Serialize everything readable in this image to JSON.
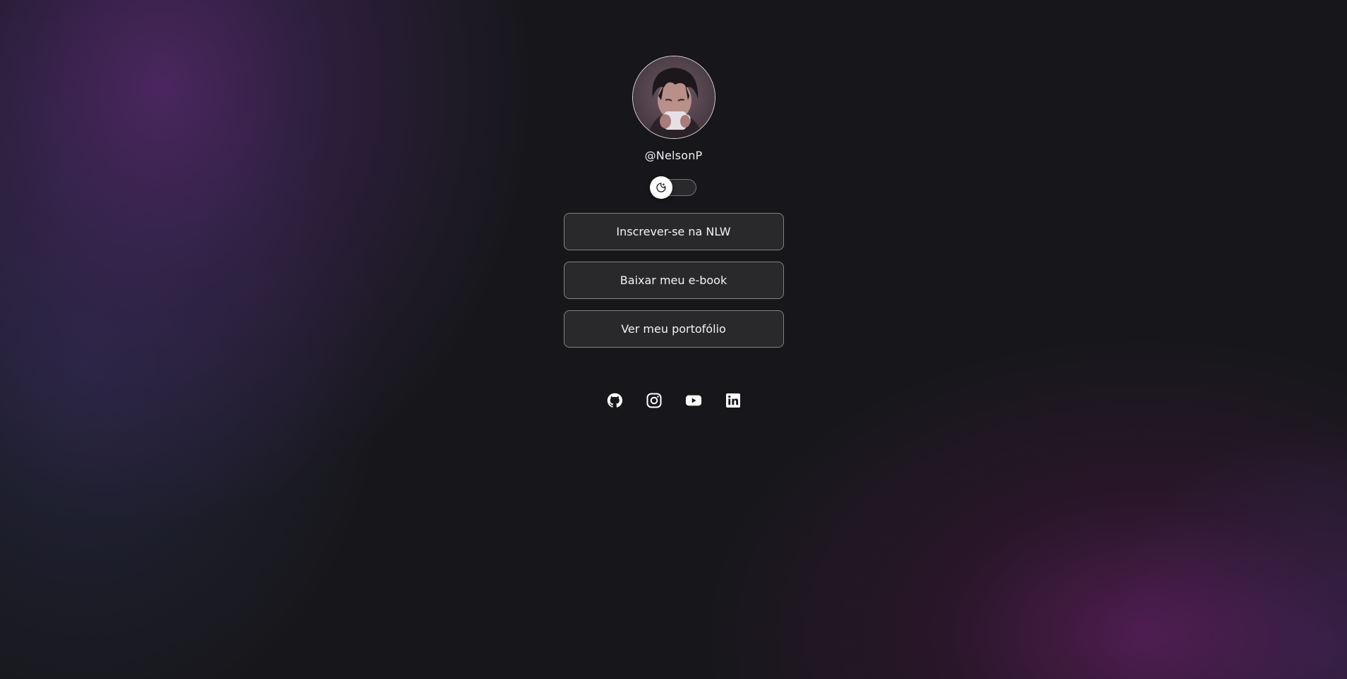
{
  "profile": {
    "username": "@NelsonP",
    "avatar_icon": "profile-avatar-illustration"
  },
  "theme_switch": {
    "icon": "moon-icon",
    "state": "dark"
  },
  "links": [
    {
      "label": "Inscrever-se na NLW"
    },
    {
      "label": "Baixar meu e-book"
    },
    {
      "label": "Ver meu portofólio"
    }
  ],
  "social": [
    {
      "icon": "github-icon"
    },
    {
      "icon": "instagram-icon"
    },
    {
      "icon": "youtube-icon"
    },
    {
      "icon": "linkedin-icon"
    }
  ],
  "colors": {
    "background": "#17171b",
    "accent_purple": "#582a70",
    "accent_magenta": "#5c1e5c",
    "text": "#f1f1f1"
  }
}
